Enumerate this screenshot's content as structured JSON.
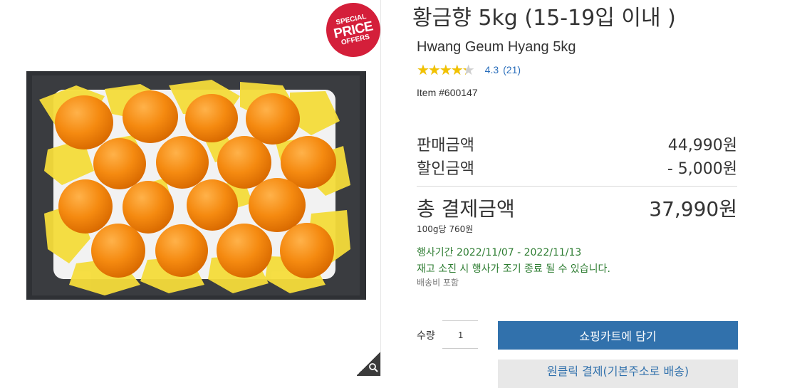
{
  "product": {
    "title": "황금향 5kg (15-19입 이내 )",
    "subtitle": "Hwang Geum Hyang 5kg",
    "rating": {
      "value": 4.3,
      "value_text": "4.3",
      "count_text": "(21)",
      "stars_glyph": "★★★★★"
    },
    "item_number": "Item #600147"
  },
  "badge": {
    "line1": "SPECIAL",
    "line2": "PRICE",
    "line3": "OFFERS",
    "color": "#d41f3a"
  },
  "pricing": {
    "sale_label": "판매금액",
    "sale_value": "44,990원",
    "discount_label": "할인금액",
    "discount_value": "- 5,000원",
    "total_label": "총 결제금액",
    "total_value": "37,990원",
    "unit_price": "100g당 760원"
  },
  "promotion": {
    "period": "행사기간 2022/11/07 - 2022/11/13",
    "notice": "재고 소진 시 행사가 조기 종료 될 수 있습니다.",
    "color": "#2e7d32"
  },
  "shipping_note": "배송비 포함",
  "purchase": {
    "qty_label": "수량",
    "qty_value": "1",
    "add_to_cart": "쇼핑카트에 담기",
    "one_click": "원클릭 결제(기본주소로 배송)",
    "primary_color": "#3171ac"
  },
  "icons": {
    "zoom": "magnifier-icon",
    "star": "star-icon"
  }
}
